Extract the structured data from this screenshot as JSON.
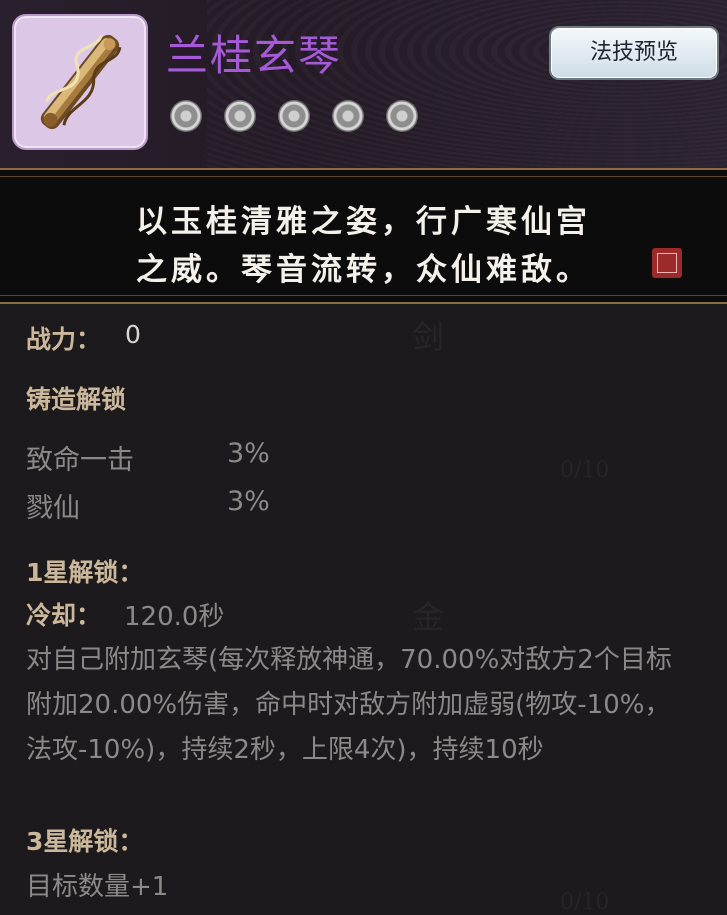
{
  "item": {
    "name": "兰桂玄琴",
    "stars": [
      "star-icon",
      "star-icon",
      "star-icon",
      "star-icon",
      "star-icon"
    ]
  },
  "preview_button": "法技预览",
  "poem": {
    "line1": "以玉桂清雅之姿，行广寒仙宫",
    "line2": "之威。琴音流转，众仙难敌。"
  },
  "power": {
    "label": "战力：",
    "value": "0"
  },
  "forge": {
    "title": "铸造解锁",
    "stats": [
      {
        "name": "致命一击",
        "value": "3%"
      },
      {
        "name": "戮仙",
        "value": "3%"
      }
    ]
  },
  "star1": {
    "title": "1星解锁：",
    "cooldown_label": "冷却：",
    "cooldown_value": "120.0秒",
    "description": "对自己附加玄琴(每次释放神通，70.00%对敌方2个目标附加20.00%伤害，命中时对敌方附加虚弱(物攻-10%，法攻-10%)，持续2秒，上限4次)，持续10秒"
  },
  "star3": {
    "title": "3星解锁：",
    "description": "目标数量+1"
  },
  "background_text": {
    "ghost1": "剑",
    "ghost2": "0/10",
    "ghost3": "金",
    "ghost4": "0/10"
  }
}
